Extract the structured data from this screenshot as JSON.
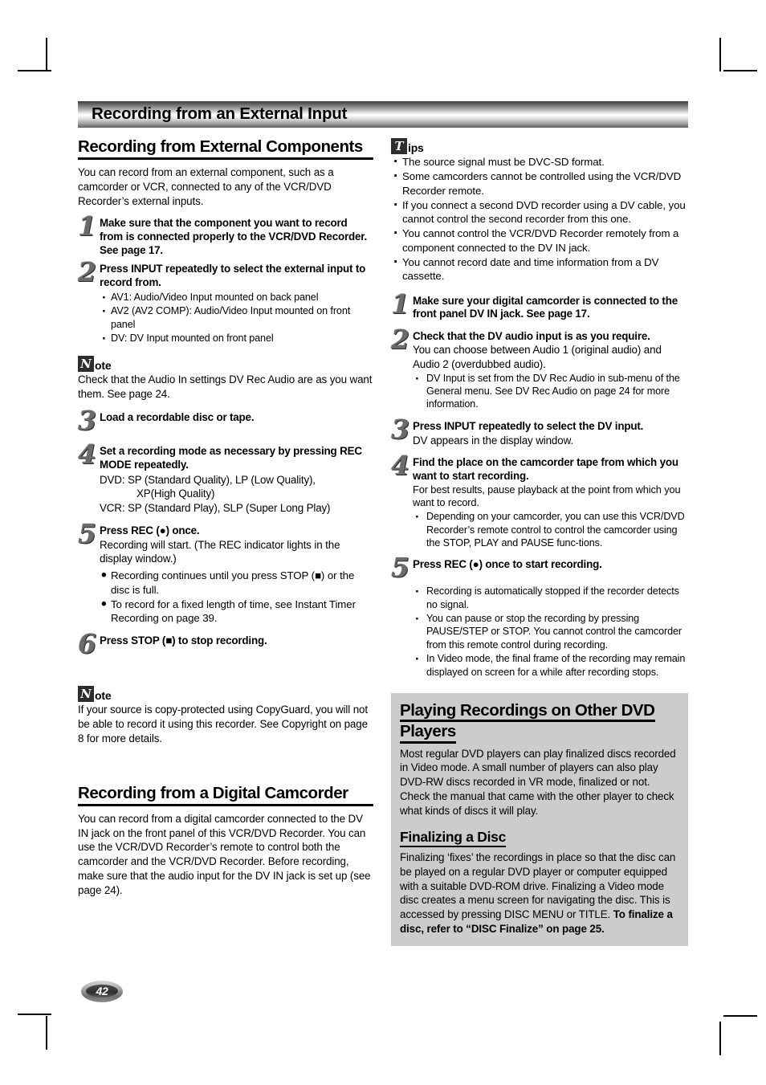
{
  "banner": {
    "title": "Recording from an External Input"
  },
  "left": {
    "section_heading": "Recording from External Components",
    "intro": "You can record from an external component, such as a camcorder or VCR, connected to any of the VCR/DVD Recorder’s external inputs.",
    "steps": [
      {
        "num": "1",
        "title": "Make sure that the component you want to record from is connected properly to the VCR/DVD Recorder. See page 17."
      },
      {
        "num": "2",
        "title": "Press INPUT repeatedly to select the external input to record from.",
        "bullets": [
          "AV1: Audio/Video Input mounted on back panel",
          "AV2 (AV2 COMP): Audio/Video Input mounted on front panel",
          "DV: DV Input mounted on front panel"
        ]
      },
      {
        "num": "3",
        "title": "Load a recordable disc or tape."
      },
      {
        "num": "4",
        "title": "Set a recording mode as necessary by pressing REC MODE repeatedly.",
        "mode_dvd": "DVD:  SP (Standard Quality), LP (Low Quality),",
        "mode_dvd2": "XP(High Quality)",
        "mode_vcr": "VCR: SP (Standard Play), SLP (Super Long Play)"
      },
      {
        "num": "5",
        "title": "Press REC (●) once.",
        "sub": "Recording will start. (The REC indicator lights in the display window.)",
        "bullets": [
          "Recording continues until you press STOP (■) or the disc is full.",
          "To record for a fixed length of time, see Instant Timer Recording on page 39."
        ]
      },
      {
        "num": "6",
        "title": "Press STOP (■) to stop recording."
      }
    ],
    "note1": {
      "badge": "N",
      "word": "ote",
      "text": "Check that the Audio In settings DV Rec Audio are as you want them. See page 24."
    },
    "note2": {
      "badge": "N",
      "word": "ote",
      "text": "If your source is copy-protected using CopyGuard, you will not be able to record it using this recorder. See Copyright on page 8 for more details."
    },
    "camcorder_heading": "Recording from a Digital Camcorder",
    "camcorder_intro": "You can record from a digital camcorder connected to the DV IN jack on the front panel of this VCR/DVD Recorder. You can use the VCR/DVD Recorder’s remote to control both the camcorder and the VCR/DVD Recorder. Before recording, make sure that the audio input for the DV IN jack is set up (see page 24)."
  },
  "right": {
    "tips": {
      "badge": "T",
      "word": "ips",
      "items": [
        "The source signal must be DVC-SD format.",
        "Some camcorders cannot be controlled using the VCR/DVD Recorder remote.",
        "If you connect a second DVD recorder using a DV cable, you cannot control the second recorder from this one.",
        "You cannot control the VCR/DVD Recorder remotely from a component connected to the DV IN jack.",
        "You cannot record date and time information from a DV cassette."
      ]
    },
    "steps": [
      {
        "num": "1",
        "title": "Make sure your digital camcorder is connected to the front panel DV IN jack. See page 17."
      },
      {
        "num": "2",
        "title": "Check that the DV audio input is as you require.",
        "sub": "You can choose between Audio 1 (original audio) and Audio 2 (overdubbed audio).",
        "bullets": [
          "DV Input is set from the DV Rec Audio in sub-menu of the General menu. See DV Rec Audio on page 24 for more information."
        ]
      },
      {
        "num": "3",
        "title": "Press INPUT repeatedly to select the DV input.",
        "sub": "DV appears in the display window."
      },
      {
        "num": "4",
        "title": "Find the place on the camcorder tape from which you want to start recording.",
        "sub": "For best results, pause playback at the point from which you want to record.",
        "bullets": [
          "Depending on your camcorder, you can use this VCR/DVD Recorder’s remote control to control the camcorder using the STOP, PLAY and PAUSE func-tions."
        ]
      },
      {
        "num": "5",
        "title": "Press REC (●) once to start recording.",
        "bullets": [
          "Recording is automatically stopped if the recorder detects no signal.",
          "You can pause or stop the recording by pressing PAUSE/STEP or STOP. You cannot control the camcorder from this remote control during recording.",
          "In Video mode, the final frame of the recording may remain displayed on screen for a while after recording stops."
        ]
      }
    ],
    "graybox": {
      "heading_line1": "Playing Recordings on Other DVD",
      "heading_line2": "Players",
      "paragraph": "Most regular DVD players can play finalized discs recorded in Video mode. A small number of players can also play DVD-RW discs recorded in VR mode, finalized or not. Check the manual that came with the other player to check what kinds of discs it will play.",
      "sub_heading": "Finalizing a Disc",
      "sub_paragraph_plain": "Finalizing ‘fixes’ the recordings in place so that the disc can be played on a regular DVD player or computer equipped with a suitable DVD-ROM drive. Finalizing a Video mode disc creates a menu screen for navigating the disc. This is accessed by pressing DISC MENU or TITLE. ",
      "sub_paragraph_bold": "To finalize a disc, refer to “DISC Finalize” on page 25."
    }
  },
  "footer": {
    "page_number": "42"
  }
}
